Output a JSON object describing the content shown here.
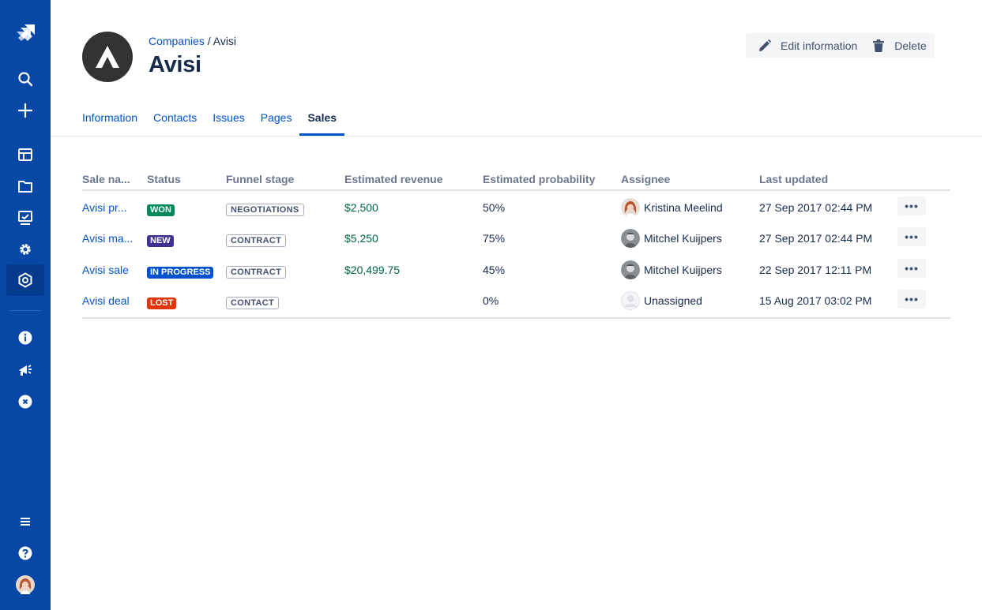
{
  "breadcrumb": {
    "parent": "Companies",
    "separator": " / ",
    "current": "Avisi"
  },
  "title": "Avisi",
  "actions": {
    "edit": "Edit information",
    "delete": "Delete"
  },
  "tabs": [
    "Information",
    "Contacts",
    "Issues",
    "Pages",
    "Sales"
  ],
  "active_tab": "Sales",
  "table": {
    "headers": [
      "Sale na...",
      "Status",
      "Funnel stage",
      "Estimated revenue",
      "Estimated probability",
      "Assignee",
      "Last updated"
    ],
    "rows": [
      {
        "name": "Avisi pr...",
        "status": "WON",
        "status_color": "#00875a",
        "stage": "NEGOTIATIONS",
        "revenue": "$2,500",
        "probability": "50%",
        "assignee": "Kristina Meelind",
        "updated": "27 Sep 2017 02:44 PM"
      },
      {
        "name": "Avisi ma...",
        "status": "NEW",
        "status_color": "#403294",
        "stage": "CONTRACT",
        "revenue": "$5,250",
        "probability": "75%",
        "assignee": "Mitchel Kuijpers",
        "updated": "27 Sep 2017 02:44 PM"
      },
      {
        "name": "Avisi sale",
        "status": "IN PROGRESS",
        "status_color": "#0052cc",
        "stage": "CONTRACT",
        "revenue": "$20,499.75",
        "probability": "45%",
        "assignee": "Mitchel Kuijpers",
        "updated": "22 Sep 2017 12:11 PM"
      },
      {
        "name": "Avisi deal",
        "status": "LOST",
        "status_color": "#de350b",
        "stage": "CONTACT",
        "revenue": "",
        "probability": "0%",
        "assignee": "Unassigned",
        "updated": "15 Aug 2017 03:02 PM"
      }
    ],
    "more_label": "•••"
  },
  "colors": {
    "sidebar": "#0747a6",
    "link": "#0052cc",
    "revenue": "#006644"
  },
  "sidebar_icons": [
    "jira-logo-icon",
    "search-icon",
    "plus-icon",
    "board-icon",
    "folder-icon",
    "dashboard-icon",
    "gear-icon",
    "app-icon",
    "info-icon",
    "megaphone-icon",
    "close-circle-icon",
    "menu-icon",
    "help-icon",
    "user-avatar"
  ]
}
